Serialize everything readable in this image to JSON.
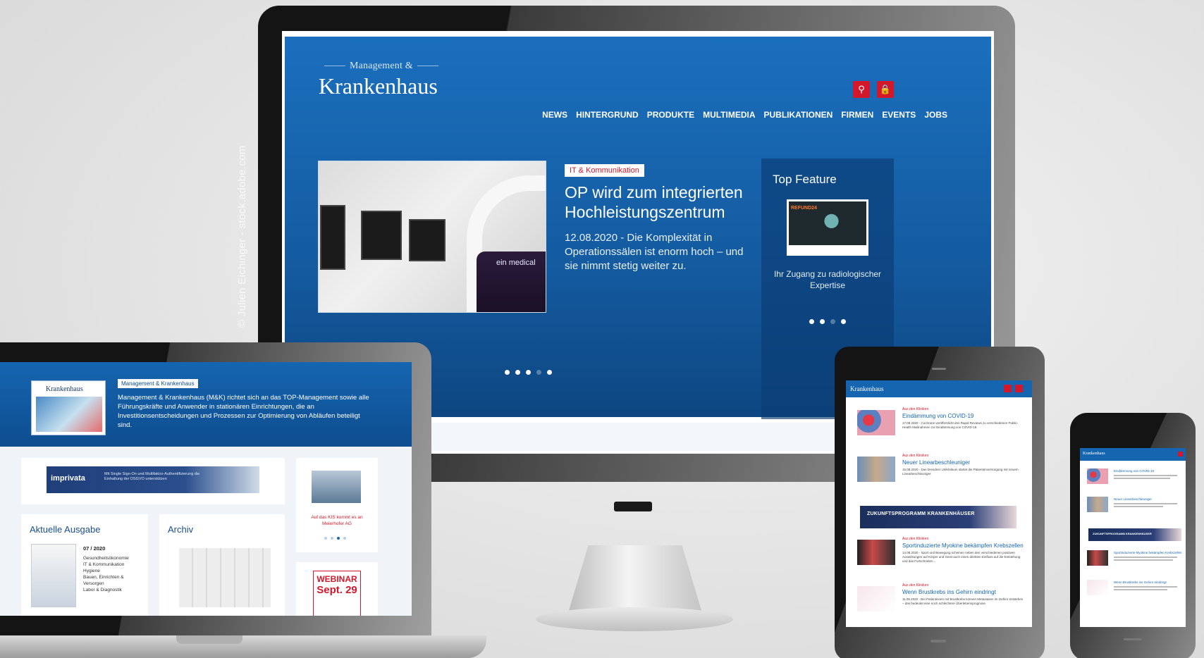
{
  "credit": "© Julien Eichinger - stock.adobe.com",
  "colors": {
    "brand_blue": "#1565b0",
    "accent_red": "#d3182b"
  },
  "desktop": {
    "logo_small": "Management &",
    "logo_big": "Krankenhaus",
    "nav": [
      "NEWS",
      "HINTERGRUND",
      "PRODUKTE",
      "MULTIMEDIA",
      "PUBLIKATIONEN",
      "FIRMEN",
      "EVENTS",
      "JOBS"
    ],
    "icons": {
      "search": "search-icon",
      "lock": "lock-icon"
    },
    "hero": {
      "image_brand": "ein medical",
      "tag": "IT & Kommunikation",
      "headline": "OP wird zum integrierten Hochleistungszentrum",
      "teaser": "12.08.2020 -   Die Komplexität in Operationssälen ist enorm hoch – und sie nimmt stetig weiter zu.",
      "slides_total": 5,
      "slide_active_dim_index": 3
    },
    "top_feature": {
      "title": "Top Feature",
      "image_label": "REFUND24",
      "text": "Ihr Zugang zu radiologischer Expertise",
      "slides_total": 4,
      "slide_dim_index": 2
    }
  },
  "laptop": {
    "mag_title": "Krankenhaus",
    "tag": "Management & Krankenhaus",
    "intro": "Management & Krankenhaus (M&K) richtet sich an das TOP-Management sowie alle Führungskräfte und Anwender in stationären Einrichtungen, die an Investitionsentscheidungen und Prozessen zur Optimierung von Abläufen beteiligt sind.",
    "banner_brand": "imprivata",
    "banner_claim": "Mit Single Sign-On und Multifaktor-Authentifizierung die Einhaltung der DSGVO unterstützen",
    "side_text": "Auf das KIS kommt es an Meierhofer AG",
    "current_issue": {
      "title": "Aktuelle Ausgabe",
      "number": "07 / 2020",
      "topics": [
        "Gesundheitsökonomie",
        "IT & Kommunikation",
        "Hygiene",
        "Bauen, Einrichten & Versorgen",
        "Labor & Diagnostik"
      ]
    },
    "archive": {
      "title": "Archiv"
    },
    "webinar": {
      "line1": "WEBINAR",
      "line2": "Sept. 29"
    }
  },
  "tablet": {
    "logo": "Krankenhaus",
    "banner": "ZUKUNFTSPROGRAMM KRANKENHÄUSER",
    "items": [
      {
        "kicker": "Aus den Kliniken",
        "title": "Eindämmung von COVID-19",
        "body": "17.08.2020 - Cochrane veröffentlicht drei Rapid Reviews zu verschiedenen Public-Health Maßnahmen zur Eindämmung von COVID-19."
      },
      {
        "kicker": "Aus den Kliniken",
        "title": "Neuer Linearbeschleuniger",
        "body": "15.08.2020 - Das Dresdner Uniklinikum startet die Patientenversorgung mit neuem Linearbeschleuniger."
      },
      {
        "kicker": "Aus den Kliniken",
        "title": "Sportinduzierte Myokine bekämpfen Krebszellen",
        "body": "14.08.2020 - Sport und Bewegung scheinen neben den verschiedenen positiven Auswirkungen auf Körper und Geist auch einen direkten Einfluss auf die Entstehung und das Fortschreiten..."
      },
      {
        "kicker": "Aus den Kliniken",
        "title": "Wenn Brustkrebs ins Gehirn eindringt",
        "body": "11.08.2020 - Bei Patientinnen mit Brustkrebs können Metastasen im Gehirn entstehen – das bedeutet eine noch schlechtere Überlebensprognose."
      }
    ]
  },
  "phone": {
    "logo": "Krankenhaus",
    "banner": "ZUKUNFTSPROGRAMM KRANKENHÄUSER",
    "items": [
      {
        "title": "Eindämmung von COVID-19"
      },
      {
        "title": "Neuer Linearbeschleuniger"
      },
      {
        "title": "Sportinduzierte Myokine bekämpfen Krebszellen"
      },
      {
        "title": "Wenn Brustkrebs ins Gehirn eindringt"
      }
    ]
  }
}
